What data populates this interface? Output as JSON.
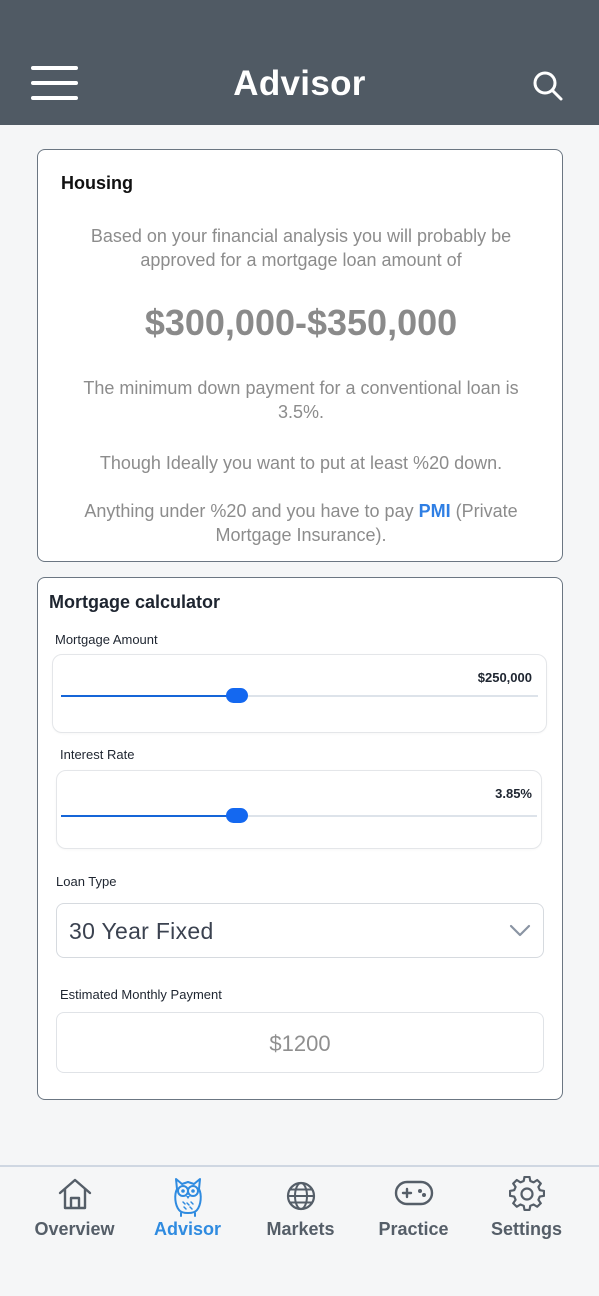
{
  "header": {
    "title": "Advisor"
  },
  "housing": {
    "title": "Housing",
    "intro": "Based on your financial analysis you will probably be approved for a mortgage loan amount of",
    "amount_range": "$300,000-$350,000",
    "min_down": "The minimum down payment for a conventional loan is 3.5%.",
    "ideal_down": "Though Ideally you want to put at least %20 down.",
    "pmi_prefix": "Anything under %20 and you have to pay ",
    "pmi_link": "PMI",
    "pmi_suffix": " (Private Mortgage Insurance)."
  },
  "calculator": {
    "title": "Mortgage calculator",
    "mortgage_amount": {
      "label": "Mortgage Amount",
      "value": "$250,000",
      "level": 0.37
    },
    "interest_rate": {
      "label": "Interest Rate",
      "value": "3.85%",
      "level": 0.37
    },
    "loan_type": {
      "label": "Loan Type",
      "value": "30 Year Fixed"
    },
    "monthly_payment": {
      "label": "Estimated Monthly Payment",
      "value": "$1200"
    }
  },
  "tabs": [
    {
      "label": "Overview",
      "icon": "home-icon"
    },
    {
      "label": "Advisor",
      "icon": "owl-icon",
      "active": true
    },
    {
      "label": "Markets",
      "icon": "globe-icon"
    },
    {
      "label": "Practice",
      "icon": "gamepad-icon"
    },
    {
      "label": "Settings",
      "icon": "gear-icon"
    }
  ],
  "colors": {
    "header": "#505a64",
    "accent": "#2f8be0",
    "slider": "#1468f0",
    "link": "#2f7fe4"
  }
}
